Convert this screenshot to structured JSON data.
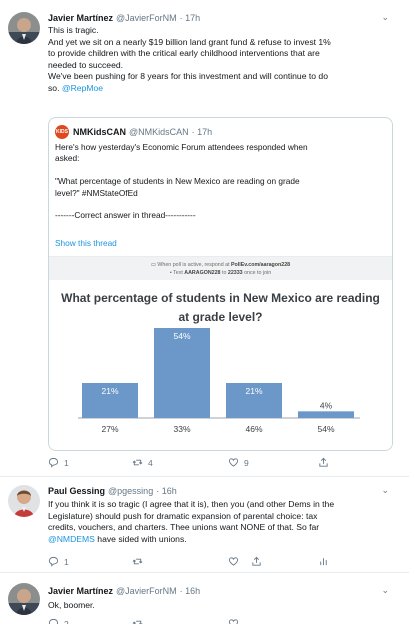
{
  "tweets": [
    {
      "name": "Javier Martínez",
      "handle": "@JavierForNM",
      "time": "· 17h",
      "lines": [
        "This is tragic.",
        "And yet we sit on a nearly $19 billion land grant fund & refuse to invest 1%",
        "to provide children with the critical early childhood interventions that are",
        "needed to succeed.",
        "We've been pushing for 8 years for this investment and will continue to do"
      ],
      "last_line_prefix": "so. ",
      "last_line_mention": "@RepMoe",
      "replies": "1",
      "retweets": "4",
      "likes": "9"
    },
    {
      "name": "Paul Gessing",
      "handle": "@pgessing",
      "time": "· 16h",
      "lines": [
        "If you think it is so tragic (I agree that it is), then you (and other Dems in the",
        "Legislature) should push for dramatic expansion of parental choice: tax",
        "credits, vouchers, and charters. Thee unions want NONE of that. So far"
      ],
      "last_line_mention": "@NMDEMS",
      "last_line_suffix": " have sided with unions.",
      "replies": "1",
      "retweets": "",
      "likes": ""
    },
    {
      "name": "Javier Martínez",
      "handle": "@JavierForNM",
      "time": "· 16h",
      "lines": [
        "Ok, boomer."
      ],
      "replies": "2"
    }
  ],
  "quote": {
    "name": "NMKidsCAN",
    "handle": "@NMKidsCAN",
    "time": "· 17h",
    "logo_text": "KIDS",
    "lines": [
      "Here's how yesterday's Economic Forum attendees responded when",
      "asked:",
      "",
      "\"What percentage of students in New Mexico are reading on grade",
      "level?\" #NMStateOfEd",
      "",
      "-------Correct answer in thread-----------"
    ],
    "show_thread": "Show this thread"
  },
  "poll": {
    "banner_line1_prefix": "When poll is active, respond at ",
    "banner_line1_link": "PollEv.com/aaragon228",
    "banner_line2_prefix": "Text ",
    "banner_line2_code": "AARAGON228",
    "banner_line2_mid": " to ",
    "banner_line2_number": "22333",
    "banner_line2_suffix": " once to join",
    "title_line1": "What percentage of students in New Mexico are reading",
    "title_line2": "at grade level?"
  },
  "chart_data": {
    "type": "bar",
    "title": "What percentage of students in New Mexico are reading at grade level?",
    "categories": [
      "27%",
      "33%",
      "46%",
      "54%"
    ],
    "values": [
      21,
      54,
      21,
      4
    ],
    "value_labels": [
      "21%",
      "54%",
      "21%",
      "4%"
    ],
    "ylim": [
      0,
      54
    ],
    "bar_color": "#6b97c9",
    "grid": false
  }
}
